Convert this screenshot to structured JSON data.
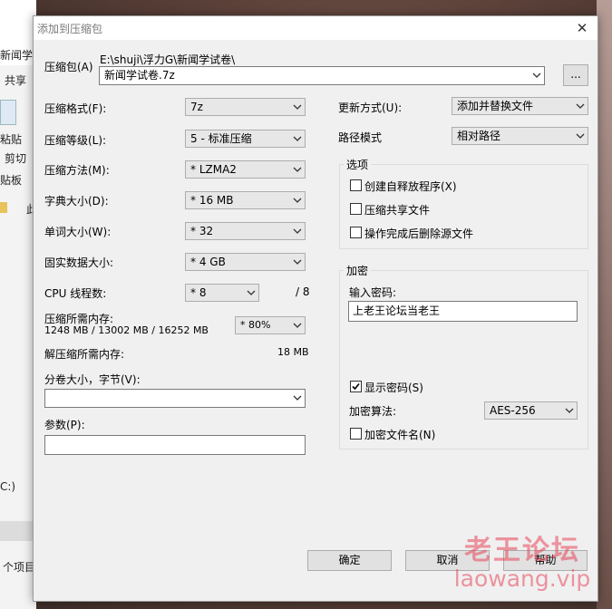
{
  "background": {
    "tab_title": "新闻学试",
    "share_label": "共享",
    "paste_label": "粘贴",
    "cut_label": "剪切",
    "clipboard_label": "贴板",
    "nav_text": "此",
    "drive_label": "C:)",
    "items_label": "个项目"
  },
  "dialog": {
    "title": "添加到压缩包",
    "archive": {
      "label": "压缩包(A)",
      "path": "E:\\shuji\\浮力G\\新闻学试卷\\",
      "name": "新闻学试卷.7z",
      "browse": "..."
    },
    "left": {
      "format_label": "压缩格式(F):",
      "format_value": "7z",
      "level_label": "压缩等级(L):",
      "level_value": "5 - 标准压缩",
      "method_label": "压缩方法(M):",
      "method_value": "* LZMA2",
      "dict_label": "字典大小(D):",
      "dict_value": "* 16 MB",
      "word_label": "单词大小(W):",
      "word_value": "* 32",
      "solid_label": "固实数据大小:",
      "solid_value": "* 4 GB",
      "cpu_label": "CPU 线程数:",
      "cpu_value": "* 8",
      "cpu_total": "/ 8",
      "mem_label": "压缩所需内存:",
      "mem_detail": "1248 MB / 13002 MB / 16252 MB",
      "mem_percent": "* 80%",
      "decomp_label": "解压缩所需内存:",
      "decomp_value": "18 MB",
      "volume_label": "分卷大小，字节(V):",
      "volume_value": "",
      "params_label": "参数(P):",
      "params_value": ""
    },
    "right": {
      "update_label": "更新方式(U):",
      "update_value": "添加并替换文件",
      "path_label": "路径模式",
      "path_value": "相对路径",
      "options": {
        "title": "选项",
        "sfx": "创建自释放程序(X)",
        "shared": "压缩共享文件",
        "delete": "操作完成后删除源文件"
      },
      "encryption": {
        "title": "加密",
        "password_label": "输入密码:",
        "password_value": "上老王论坛当老王",
        "show_password": "显示密码(S)",
        "method_label": "加密算法:",
        "method_value": "AES-256",
        "encrypt_names": "加密文件名(N)"
      }
    },
    "buttons": {
      "ok": "确定",
      "cancel": "取消",
      "help": "帮助"
    }
  },
  "watermark": {
    "cn": "老王论坛",
    "en": "laowang.vip"
  }
}
